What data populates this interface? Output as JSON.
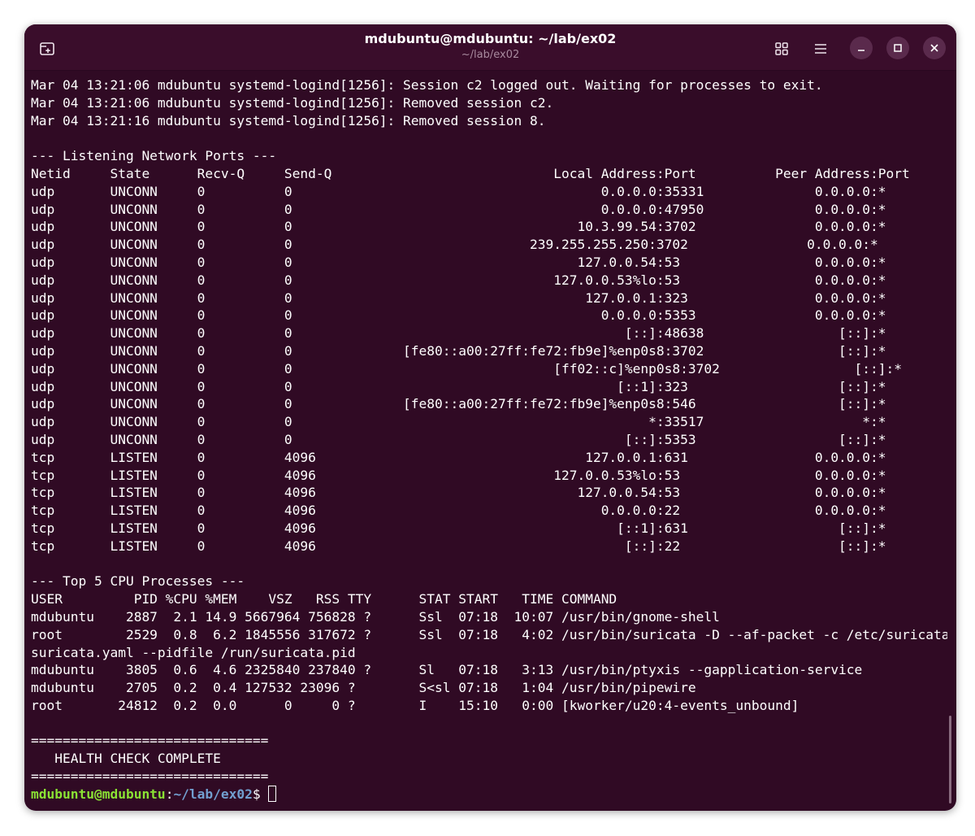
{
  "window": {
    "title": "mdubuntu@mdubuntu: ~/lab/ex02",
    "subtitle": "~/lab/ex02"
  },
  "icons": {
    "new_tab": "new-tab-icon",
    "grid": "grid-view-icon",
    "menu": "hamburger-menu-icon",
    "minimize": "minimize-icon",
    "maximize": "maximize-icon",
    "close": "close-icon"
  },
  "colors": {
    "terminal_bg": "#300a24",
    "titlebar_bg": "#3a0d2b",
    "prompt_user": "#8ae234",
    "prompt_path": "#729fcf"
  },
  "terminal": {
    "lines": [
      "Mar 04 13:21:06 mdubuntu systemd-logind[1256]: Session c2 logged out. Waiting for processes to exit.",
      "Mar 04 13:21:06 mdubuntu systemd-logind[1256]: Removed session c2.",
      "Mar 04 13:21:16 mdubuntu systemd-logind[1256]: Removed session 8.",
      "",
      "--- Listening Network Ports ---",
      "Netid     State      Recv-Q     Send-Q                            Local Address:Port          Peer Address:Port",
      "udp       UNCONN     0          0                                       0.0.0.0:35331              0.0.0.0:*",
      "udp       UNCONN     0          0                                       0.0.0.0:47950              0.0.0.0:*",
      "udp       UNCONN     0          0                                    10.3.99.54:3702               0.0.0.0:*",
      "udp       UNCONN     0          0                              239.255.255.250:3702               0.0.0.0:*",
      "udp       UNCONN     0          0                                    127.0.0.54:53                 0.0.0.0:*",
      "udp       UNCONN     0          0                                 127.0.0.53%lo:53                 0.0.0.0:*",
      "udp       UNCONN     0          0                                     127.0.0.1:323                0.0.0.0:*",
      "udp       UNCONN     0          0                                       0.0.0.0:5353               0.0.0.0:*",
      "udp       UNCONN     0          0                                          [::]:48638                 [::]:*",
      "udp       UNCONN     0          0              [fe80::a00:27ff:fe72:fb9e]%enp0s8:3702                 [::]:*",
      "udp       UNCONN     0          0                                 [ff02::c]%enp0s8:3702                 [::]:*",
      "udp       UNCONN     0          0                                         [::1]:323                   [::]:*",
      "udp       UNCONN     0          0              [fe80::a00:27ff:fe72:fb9e]%enp0s8:546                  [::]:*",
      "udp       UNCONN     0          0                                             *:33517                    *:*",
      "udp       UNCONN     0          0                                          [::]:5353                  [::]:*",
      "tcp       LISTEN     0          4096                                  127.0.0.1:631                0.0.0.0:*",
      "tcp       LISTEN     0          4096                              127.0.0.53%lo:53                 0.0.0.0:*",
      "tcp       LISTEN     0          4096                                 127.0.0.54:53                 0.0.0.0:*",
      "tcp       LISTEN     0          4096                                    0.0.0.0:22                 0.0.0.0:*",
      "tcp       LISTEN     0          4096                                      [::1]:631                   [::]:*",
      "tcp       LISTEN     0          4096                                       [::]:22                    [::]:*",
      "",
      "--- Top 5 CPU Processes ---",
      "USER         PID %CPU %MEM    VSZ   RSS TTY      STAT START   TIME COMMAND",
      "mdubuntu    2887  2.1 14.9 5667964 756828 ?      Ssl  07:18  10:07 /usr/bin/gnome-shell",
      "root        2529  0.8  6.2 1845556 317672 ?      Ssl  07:18   4:02 /usr/bin/suricata -D --af-packet -c /etc/suricata/",
      "suricata.yaml --pidfile /run/suricata.pid",
      "mdubuntu    3805  0.6  4.6 2325840 237840 ?      Sl   07:18   3:13 /usr/bin/ptyxis --gapplication-service",
      "mdubuntu    2705  0.2  0.4 127532 23096 ?        S<sl 07:18   1:04 /usr/bin/pipewire",
      "root       24812  0.2  0.0      0     0 ?        I    15:10   0:00 [kworker/u20:4-events_unbound]",
      "",
      "==============================",
      "   HEALTH CHECK COMPLETE",
      "=============================="
    ],
    "prompt": {
      "user_host": "mdubuntu@mdubuntu",
      "separator": ":",
      "path": "~/lab/ex02",
      "symbol": "$ "
    }
  }
}
